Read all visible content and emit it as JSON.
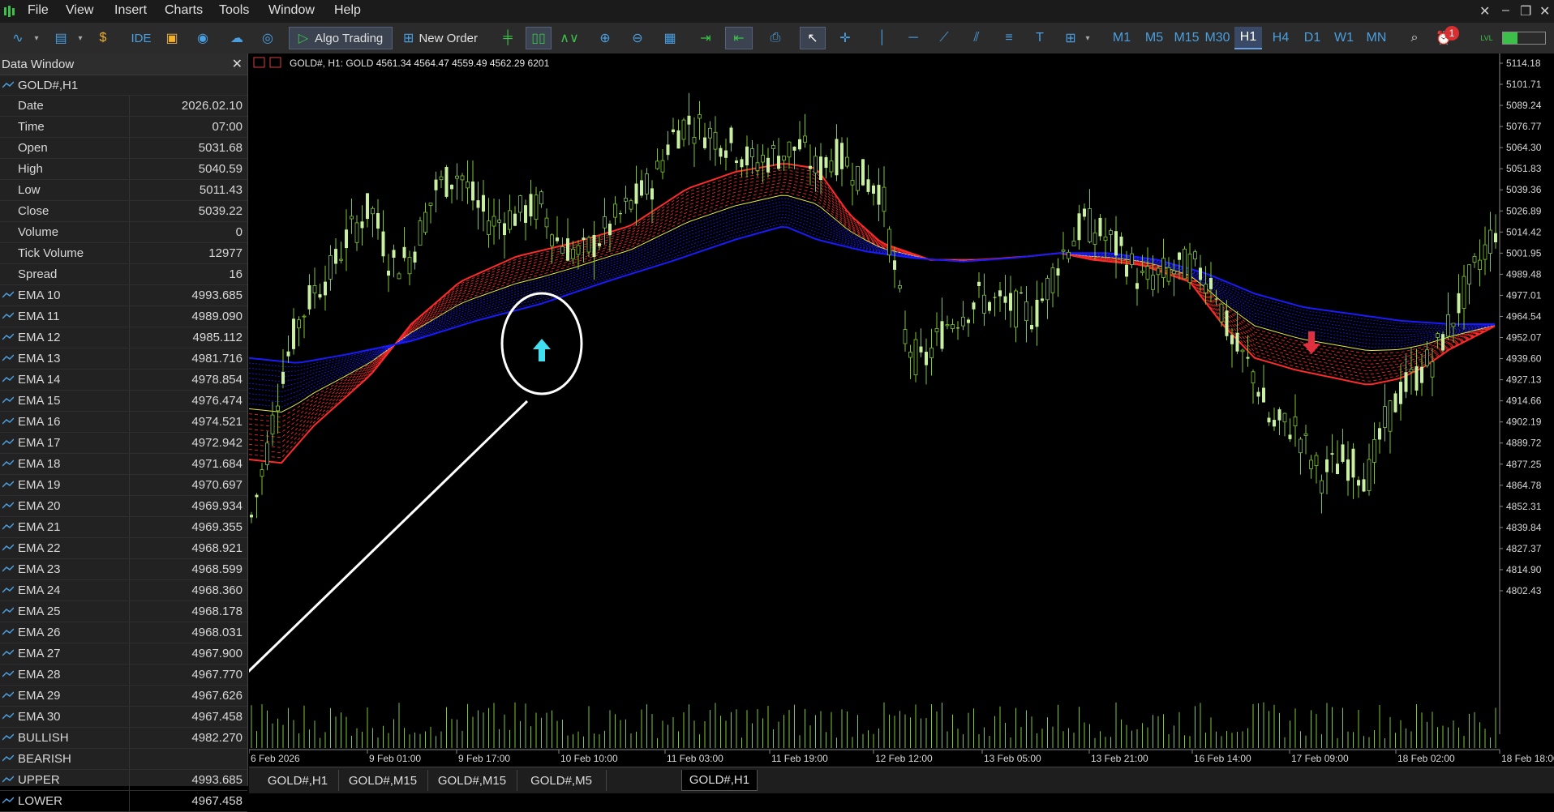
{
  "menu": [
    "File",
    "View",
    "Insert",
    "Charts",
    "Tools",
    "Window",
    "Help"
  ],
  "toolbar": {
    "ide_label": "IDE",
    "algo_trading_label": "Algo Trading",
    "new_order_label": "New Order",
    "timeframes": [
      "M1",
      "M5",
      "M15",
      "M30",
      "H1",
      "H4",
      "D1",
      "W1",
      "MN"
    ],
    "active_timeframe": "H1",
    "notification_count": "1",
    "lvl_label": "LVL"
  },
  "data_window": {
    "title": "Data Window",
    "symbol": "GOLD#,H1",
    "rows": [
      {
        "label": "Date",
        "value": "2026.02.10"
      },
      {
        "label": "Time",
        "value": "07:00"
      },
      {
        "label": "Open",
        "value": "5031.68"
      },
      {
        "label": "High",
        "value": "5040.59"
      },
      {
        "label": "Low",
        "value": "5011.43"
      },
      {
        "label": "Close",
        "value": "5039.22"
      },
      {
        "label": "Volume",
        "value": "0"
      },
      {
        "label": "Tick Volume",
        "value": "12977"
      },
      {
        "label": "Spread",
        "value": "16"
      }
    ],
    "indicators": [
      {
        "label": "EMA 10",
        "value": "4993.685"
      },
      {
        "label": "EMA 11",
        "value": "4989.090"
      },
      {
        "label": "EMA 12",
        "value": "4985.112"
      },
      {
        "label": "EMA 13",
        "value": "4981.716"
      },
      {
        "label": "EMA 14",
        "value": "4978.854"
      },
      {
        "label": "EMA 15",
        "value": "4976.474"
      },
      {
        "label": "EMA 16",
        "value": "4974.521"
      },
      {
        "label": "EMA 17",
        "value": "4972.942"
      },
      {
        "label": "EMA 18",
        "value": "4971.684"
      },
      {
        "label": "EMA 19",
        "value": "4970.697"
      },
      {
        "label": "EMA 20",
        "value": "4969.934"
      },
      {
        "label": "EMA 21",
        "value": "4969.355"
      },
      {
        "label": "EMA 22",
        "value": "4968.921"
      },
      {
        "label": "EMA 23",
        "value": "4968.599"
      },
      {
        "label": "EMA 24",
        "value": "4968.360"
      },
      {
        "label": "EMA 25",
        "value": "4968.178"
      },
      {
        "label": "EMA 26",
        "value": "4968.031"
      },
      {
        "label": "EMA 27",
        "value": "4967.900"
      },
      {
        "label": "EMA 28",
        "value": "4967.770"
      },
      {
        "label": "EMA 29",
        "value": "4967.626"
      },
      {
        "label": "EMA 30",
        "value": "4967.458"
      },
      {
        "label": "BULLISH",
        "value": "4982.270"
      },
      {
        "label": "BEARISH",
        "value": ""
      },
      {
        "label": "UPPER",
        "value": "4993.685"
      },
      {
        "label": "LOWER",
        "value": "4967.458"
      }
    ]
  },
  "chart_header": "GOLD#, H1:  GOLD  4561.34 4564.47 4559.49 4562.29  6201",
  "chart_data": {
    "type": "candlestick",
    "symbol": "GOLD#",
    "timeframe": "H1",
    "y_ticks": [
      "5114.18",
      "5101.71",
      "5089.24",
      "5076.77",
      "5064.30",
      "5051.83",
      "5039.36",
      "5026.89",
      "5014.42",
      "5001.95",
      "4989.48",
      "4977.01",
      "4964.54",
      "4952.07",
      "4939.60",
      "4927.13",
      "4914.66",
      "4902.19",
      "4889.72",
      "4877.25",
      "4864.78",
      "4852.31",
      "4839.84",
      "4827.37",
      "4814.90",
      "4802.43"
    ],
    "x_ticks": [
      "6 Feb 2026",
      "9 Feb 01:00",
      "9 Feb 17:00",
      "10 Feb 10:00",
      "11 Feb 03:00",
      "11 Feb 19:00",
      "12 Feb 12:00",
      "13 Feb 05:00",
      "13 Feb 21:00",
      "16 Feb 14:00",
      "17 Feb 09:00",
      "18 Feb 02:00",
      "18 Feb 18:00"
    ],
    "ylim": [
      4798,
      5122
    ],
    "bull_color": "#c8f0a0",
    "wick_color": "#7ec832",
    "bands": {
      "fast_color": "#ff2a2a",
      "mid_color": "#e8e84a",
      "slow_color": "#1a1aff"
    },
    "signals": [
      {
        "type": "buy",
        "label": "up-arrow"
      },
      {
        "type": "sell",
        "label": "down-arrow"
      }
    ]
  },
  "tabs": [
    "GOLD#,H1",
    "GOLD#,M15",
    "GOLD#,M15",
    "GOLD#,M5",
    "GOLD#,H1"
  ],
  "active_tab": 4
}
